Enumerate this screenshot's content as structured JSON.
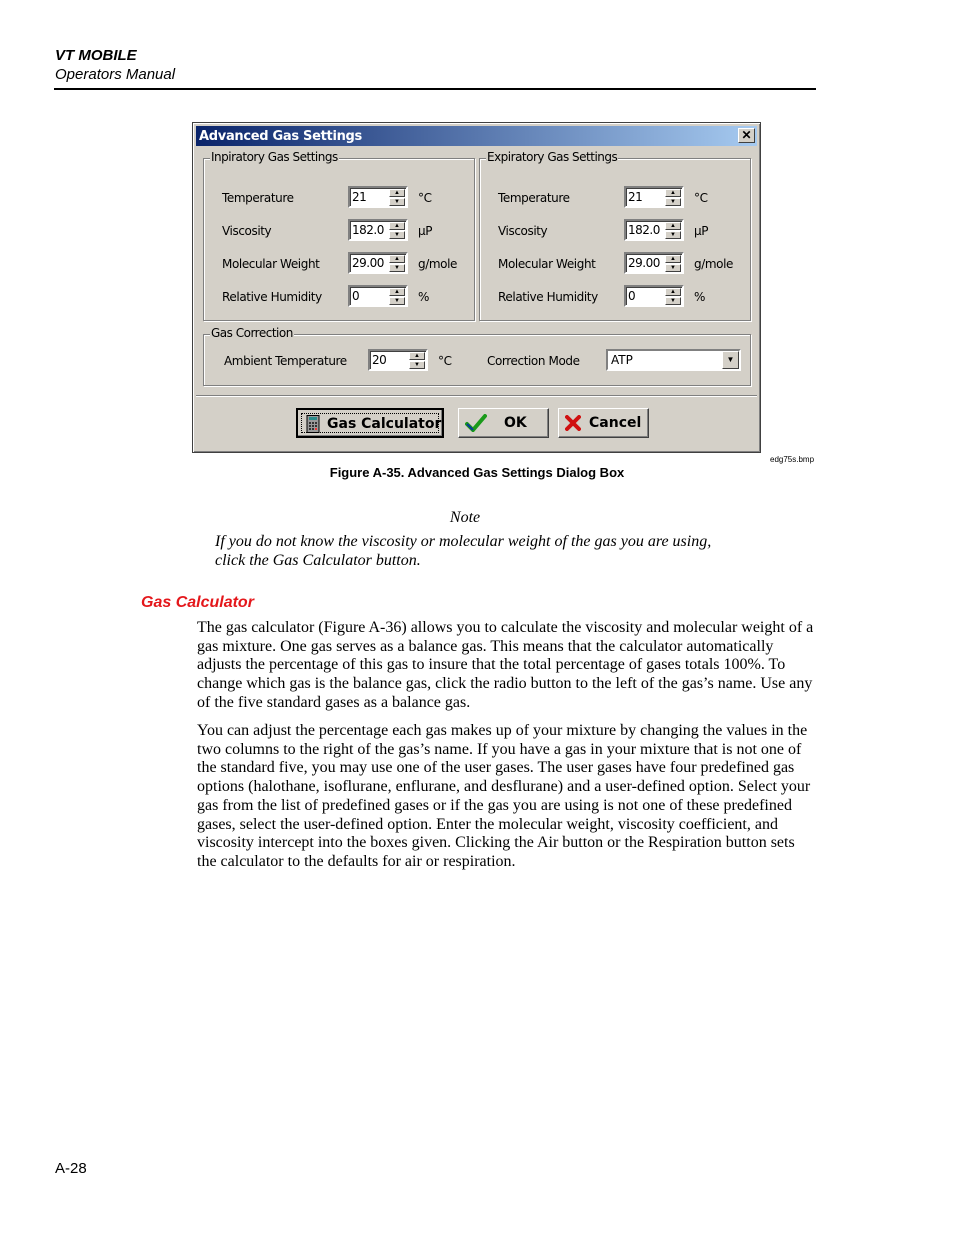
{
  "header": {
    "title": "VT MOBILE",
    "subtitle": "Operators Manual"
  },
  "dialog": {
    "title": "Advanced Gas Settings",
    "close_label": "✕",
    "inspiratory": {
      "legend": "Inpiratory Gas Settings",
      "rows": [
        {
          "label": "Temperature",
          "value": "21",
          "unit": "°C"
        },
        {
          "label": "Viscosity",
          "value": "182.0",
          "unit": "µP"
        },
        {
          "label": "Molecular Weight",
          "value": "29.00",
          "unit": "g/mole"
        },
        {
          "label": "Relative Humidity",
          "value": "0",
          "unit": "%"
        }
      ]
    },
    "expiratory": {
      "legend": "Expiratory Gas Settings",
      "rows": [
        {
          "label": "Temperature",
          "value": "21",
          "unit": "°C"
        },
        {
          "label": "Viscosity",
          "value": "182.0",
          "unit": "µP"
        },
        {
          "label": "Molecular Weight",
          "value": "29.00",
          "unit": "g/mole"
        },
        {
          "label": "Relative Humidity",
          "value": "0",
          "unit": "%"
        }
      ]
    },
    "correction": {
      "legend": "Gas Correction",
      "ambient_label": "Ambient Temperature",
      "ambient_value": "20",
      "ambient_unit": "°C",
      "mode_label": "Correction Mode",
      "mode_value": "ATP"
    },
    "buttons": {
      "calculator": {
        "label": "Gas Calculator",
        "icon": "calculator-icon"
      },
      "ok": {
        "label": "OK",
        "icon": "checkmark-icon"
      },
      "cancel": {
        "label": "Cancel",
        "icon": "x-icon"
      }
    },
    "spin_up": "▲",
    "spin_down": "▼",
    "drop_arrow": "▼"
  },
  "figure": {
    "filename": "edg75s.bmp",
    "caption": "Figure A-35. Advanced Gas Settings Dialog Box"
  },
  "note": {
    "heading": "Note",
    "body": "If you do not know the viscosity or molecular weight of the gas you are using, click the Gas Calculator button."
  },
  "section": {
    "heading": "Gas Calculator",
    "paragraphs": [
      "The gas calculator (Figure A-36) allows you to calculate the viscosity and molecular weight of a gas mixture. One gas serves as a balance gas. This means that the calculator automatically adjusts the percentage of this gas to insure that the total percentage of gases totals 100%. To change which gas is the balance gas, click the radio button to the left of the gas’s name. Use any of the five standard gases as a balance gas.",
      "You can adjust the percentage each gas makes up of your mixture by changing the values in the two columns to the right of the gas’s name. If you have a gas in your mixture that is not one of the standard five, you may use one of the user gases. The user gases have four predefined gas options (halothane, isoflurane, enflurane, and desflurane) and a user-defined option. Select your gas from the list of predefined gases or if the gas you are using is not one of these predefined gases, select the user-defined option. Enter the molecular weight, viscosity coefficient, and viscosity intercept into the boxes given. Clicking the Air button or the Respiration button sets the calculator to the defaults for air or respiration."
    ]
  },
  "page_number": "A-28"
}
